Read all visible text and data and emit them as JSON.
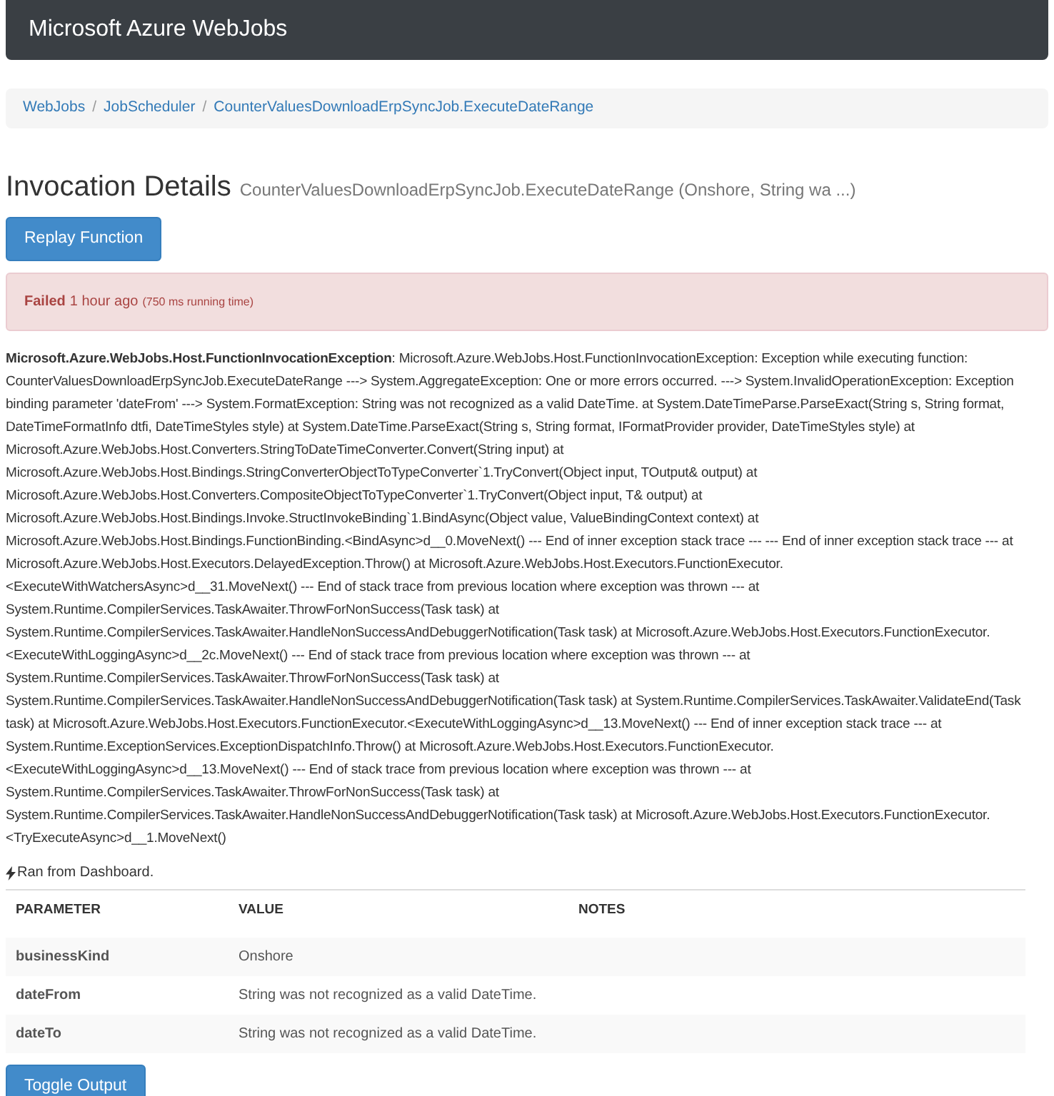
{
  "navbar": {
    "brand": "Microsoft Azure WebJobs"
  },
  "breadcrumb": [
    "WebJobs",
    "JobScheduler",
    "CounterValuesDownloadErpSyncJob.ExecuteDateRange"
  ],
  "breadcrumb_separator": "/",
  "heading": {
    "title": "Invocation Details",
    "subtitle": "CounterValuesDownloadErpSyncJob.ExecuteDateRange (Onshore, String wa ...)"
  },
  "replay_button": "Replay Function",
  "status": {
    "state": "Failed",
    "when": "1 hour ago",
    "running_time": "(750 ms running time)"
  },
  "exception": "**Microsoft.Azure.WebJobs.Host.FunctionInvocationException**: Microsoft.Azure.WebJobs.Host.FunctionInvocationException: Exception while executing function: CounterValuesDownloadErpSyncJob.ExecuteDateRange ---> System.AggregateException: One or more errors occurred. ---> System.InvalidOperationException: Exception binding parameter 'dateFrom' ---> System.FormatException: String was not recognized as a valid DateTime. at System.DateTimeParse.ParseExact(String s, String format, DateTimeFormatInfo dtfi, DateTimeStyles style) at System.DateTime.ParseExact(String s, String format, IFormatProvider provider, DateTimeStyles style) at Microsoft.Azure.WebJobs.Host.Converters.StringToDateTimeConverter.Convert(String input) at Microsoft.Azure.WebJobs.Host.Bindings.StringConverterObjectToTypeConverter`1.TryConvert(Object input, TOutput& output) at Microsoft.Azure.WebJobs.Host.Converters.CompositeObjectToTypeConverter`1.TryConvert(Object input, T& output) at Microsoft.Azure.WebJobs.Host.Bindings.Invoke.StructInvokeBinding`1.BindAsync(Object value, ValueBindingContext context) at Microsoft.Azure.WebJobs.Host.Bindings.FunctionBinding.<BindAsync>d__0.MoveNext() --- End of inner exception stack trace --- --- End of inner exception stack trace --- at Microsoft.Azure.WebJobs.Host.Executors.DelayedException.Throw() at Microsoft.Azure.WebJobs.Host.Executors.FunctionExecutor.<ExecuteWithWatchersAsync>d__31.MoveNext() --- End of stack trace from previous location where exception was thrown --- at System.Runtime.CompilerServices.TaskAwaiter.ThrowForNonSuccess(Task task) at System.Runtime.CompilerServices.TaskAwaiter.HandleNonSuccessAndDebuggerNotification(Task task) at Microsoft.Azure.WebJobs.Host.Executors.FunctionExecutor.<ExecuteWithLoggingAsync>d__2c.MoveNext() --- End of stack trace from previous location where exception was thrown --- at System.Runtime.CompilerServices.TaskAwaiter.ThrowForNonSuccess(Task task) at System.Runtime.CompilerServices.TaskAwaiter.HandleNonSuccessAndDebuggerNotification(Task task) at System.Runtime.CompilerServices.TaskAwaiter.ValidateEnd(Task task) at Microsoft.Azure.WebJobs.Host.Executors.FunctionExecutor.<ExecuteWithLoggingAsync>d__13.MoveNext() --- End of inner exception stack trace --- at System.Runtime.ExceptionServices.ExceptionDispatchInfo.Throw() at Microsoft.Azure.WebJobs.Host.Executors.FunctionExecutor.<ExecuteWithLoggingAsync>d__13.MoveNext() --- End of stack trace from previous location where exception was thrown --- at System.Runtime.CompilerServices.TaskAwaiter.ThrowForNonSuccess(Task task) at System.Runtime.CompilerServices.TaskAwaiter.HandleNonSuccessAndDebuggerNotification(Task task) at Microsoft.Azure.WebJobs.Host.Executors.FunctionExecutor.<TryExecuteAsync>d__1.MoveNext()",
  "trigger_note": "Ran from Dashboard.",
  "table": {
    "columns": [
      "PARAMETER",
      "VALUE",
      "NOTES"
    ],
    "rows": [
      {
        "parameter": "businessKind",
        "value": "Onshore"
      },
      {
        "parameter": "dateFrom",
        "value": "String was not recognized as a valid DateTime."
      },
      {
        "parameter": "dateTo",
        "value": "String was not recognized as a valid DateTime."
      }
    ]
  },
  "toggle_button": "Toggle Output"
}
